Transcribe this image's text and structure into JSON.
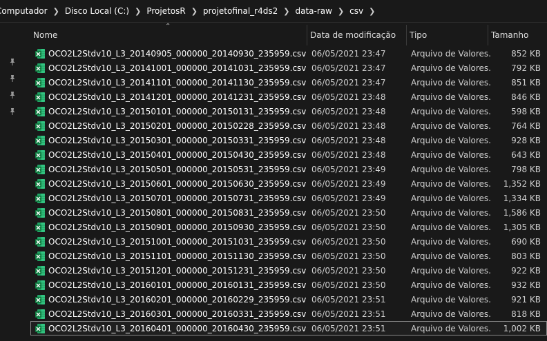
{
  "breadcrumb": [
    "Computador",
    "Disco Local (C:)",
    "ProjetosR",
    "projetofinal_r4ds2",
    "data-raw",
    "csv"
  ],
  "columns": {
    "name": "Nome",
    "modified": "Data de modificação",
    "type": "Tipo",
    "size": "Tamanho"
  },
  "rows": [
    {
      "name": "OCO2L2Stdv10_L3_20140905_000000_20140930_235959.csv",
      "modified": "06/05/2021 23:47",
      "type": "Arquivo de Valores...",
      "size": "852 KB"
    },
    {
      "name": "OCO2L2Stdv10_L3_20141001_000000_20141031_235959.csv",
      "modified": "06/05/2021 23:47",
      "type": "Arquivo de Valores...",
      "size": "792 KB"
    },
    {
      "name": "OCO2L2Stdv10_L3_20141101_000000_20141130_235959.csv",
      "modified": "06/05/2021 23:47",
      "type": "Arquivo de Valores...",
      "size": "851 KB"
    },
    {
      "name": "OCO2L2Stdv10_L3_20141201_000000_20141231_235959.csv",
      "modified": "06/05/2021 23:48",
      "type": "Arquivo de Valores...",
      "size": "846 KB"
    },
    {
      "name": "OCO2L2Stdv10_L3_20150101_000000_20150131_235959.csv",
      "modified": "06/05/2021 23:48",
      "type": "Arquivo de Valores...",
      "size": "598 KB"
    },
    {
      "name": "OCO2L2Stdv10_L3_20150201_000000_20150228_235959.csv",
      "modified": "06/05/2021 23:48",
      "type": "Arquivo de Valores...",
      "size": "764 KB"
    },
    {
      "name": "OCO2L2Stdv10_L3_20150301_000000_20150331_235959.csv",
      "modified": "06/05/2021 23:48",
      "type": "Arquivo de Valores...",
      "size": "928 KB"
    },
    {
      "name": "OCO2L2Stdv10_L3_20150401_000000_20150430_235959.csv",
      "modified": "06/05/2021 23:48",
      "type": "Arquivo de Valores...",
      "size": "643 KB"
    },
    {
      "name": "OCO2L2Stdv10_L3_20150501_000000_20150531_235959.csv",
      "modified": "06/05/2021 23:49",
      "type": "Arquivo de Valores...",
      "size": "798 KB"
    },
    {
      "name": "OCO2L2Stdv10_L3_20150601_000000_20150630_235959.csv",
      "modified": "06/05/2021 23:49",
      "type": "Arquivo de Valores...",
      "size": "1,352 KB"
    },
    {
      "name": "OCO2L2Stdv10_L3_20150701_000000_20150731_235959.csv",
      "modified": "06/05/2021 23:49",
      "type": "Arquivo de Valores...",
      "size": "1,334 KB"
    },
    {
      "name": "OCO2L2Stdv10_L3_20150801_000000_20150831_235959.csv",
      "modified": "06/05/2021 23:50",
      "type": "Arquivo de Valores...",
      "size": "1,586 KB"
    },
    {
      "name": "OCO2L2Stdv10_L3_20150901_000000_20150930_235959.csv",
      "modified": "06/05/2021 23:50",
      "type": "Arquivo de Valores...",
      "size": "1,305 KB"
    },
    {
      "name": "OCO2L2Stdv10_L3_20151001_000000_20151031_235959.csv",
      "modified": "06/05/2021 23:50",
      "type": "Arquivo de Valores...",
      "size": "690 KB"
    },
    {
      "name": "OCO2L2Stdv10_L3_20151101_000000_20151130_235959.csv",
      "modified": "06/05/2021 23:50",
      "type": "Arquivo de Valores...",
      "size": "803 KB"
    },
    {
      "name": "OCO2L2Stdv10_L3_20151201_000000_20151231_235959.csv",
      "modified": "06/05/2021 23:50",
      "type": "Arquivo de Valores...",
      "size": "922 KB"
    },
    {
      "name": "OCO2L2Stdv10_L3_20160101_000000_20160131_235959.csv",
      "modified": "06/05/2021 23:50",
      "type": "Arquivo de Valores...",
      "size": "932 KB"
    },
    {
      "name": "OCO2L2Stdv10_L3_20160201_000000_20160229_235959.csv",
      "modified": "06/05/2021 23:51",
      "type": "Arquivo de Valores...",
      "size": "921 KB"
    },
    {
      "name": "OCO2L2Stdv10_L3_20160301_000000_20160331_235959.csv",
      "modified": "06/05/2021 23:51",
      "type": "Arquivo de Valores...",
      "size": "818 KB"
    },
    {
      "name": "OCO2L2Stdv10_L3_20160401_000000_20160430_235959.csv",
      "modified": "06/05/2021 23:51",
      "type": "Arquivo de Valores...",
      "size": "1,002 KB",
      "selected": true
    }
  ],
  "colors": {
    "background": "#191919",
    "excel_green": "#107c41",
    "excel_light": "#21a366",
    "selection_border": "#8a8a8a"
  }
}
